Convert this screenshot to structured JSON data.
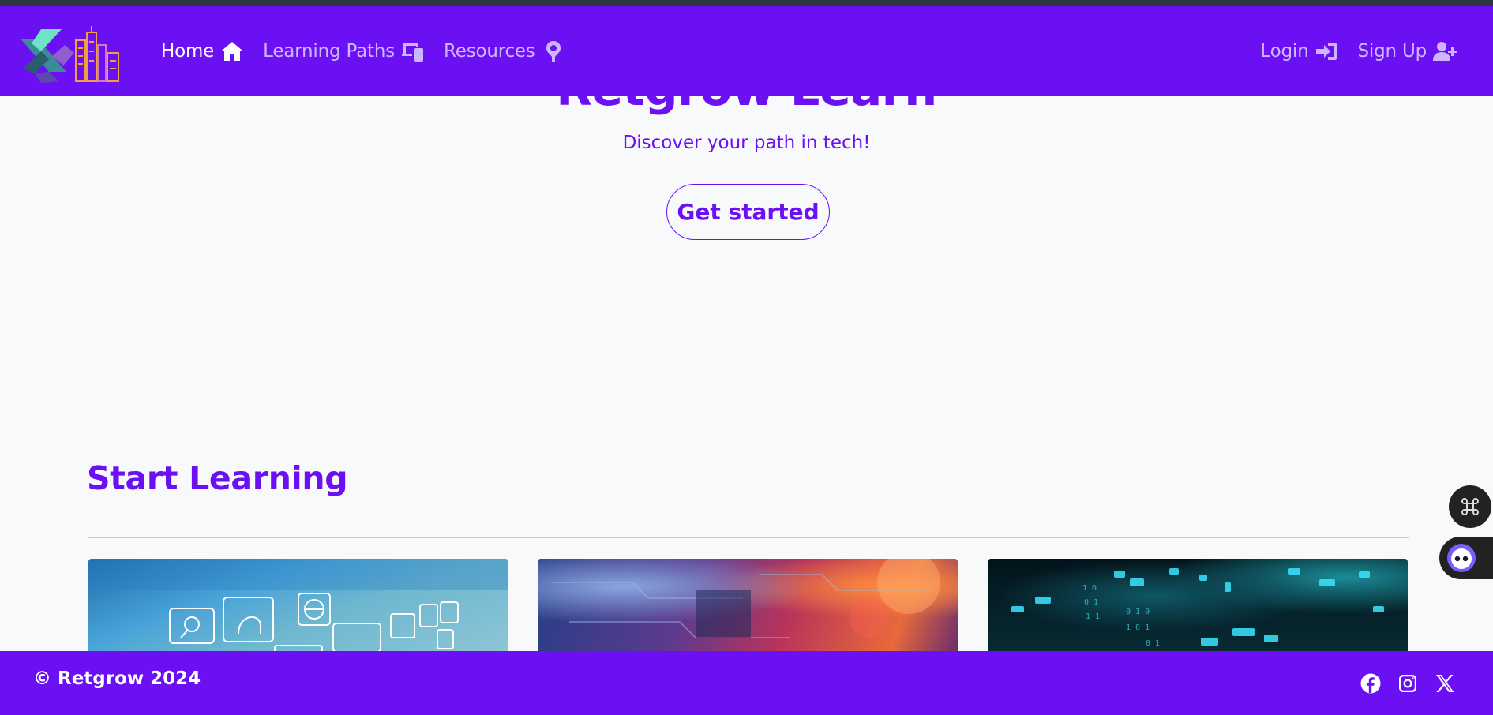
{
  "nav": {
    "home": "Home",
    "learning_paths": "Learning Paths",
    "resources": "Resources",
    "login": "Login",
    "signup": "Sign Up"
  },
  "hero": {
    "title": "Retgrow Learn",
    "subtitle": "Discover your path in tech!",
    "cta": "Get started"
  },
  "section": {
    "title": "Start Learning"
  },
  "cards": [
    {
      "image": "ai-technology-icons-photo"
    },
    {
      "image": "circuit-board-photo"
    },
    {
      "image": "digital-binary-code-photo"
    }
  ],
  "footer": {
    "copyright": "© Retgrow 2024",
    "socials": [
      "facebook-icon",
      "instagram-icon",
      "x-icon"
    ]
  },
  "colors": {
    "brand": "#6b10f2",
    "nav_inactive": "#cdb6ff",
    "background": "#f8f9fb"
  }
}
